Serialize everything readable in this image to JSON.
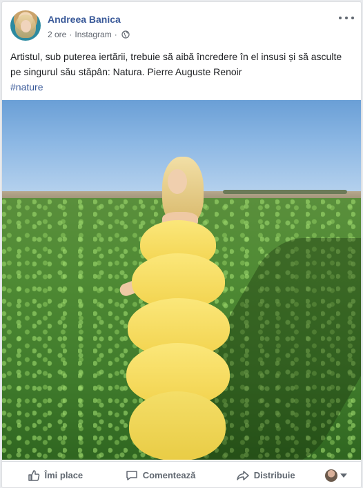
{
  "post": {
    "author": "Andreea Banica",
    "time": "2 ore",
    "separator": "·",
    "source": "Instagram",
    "text": "Artistul, sub puterea iertării, trebuie să aibă încredere în el insusi și să asculte pe singurul său stăpân: Natura. Pierre Auguste Renoir",
    "hashtag": "#nature",
    "privacy_icon": "globe-icon",
    "menu_icon": "more-icon"
  },
  "actions": {
    "like": {
      "label": "Îmi place",
      "icon": "like-icon"
    },
    "comment": {
      "label": "Comentează",
      "icon": "comment-icon"
    },
    "share": {
      "label": "Distribuie",
      "icon": "share-icon"
    },
    "audience_icon": "chevron-down-icon"
  },
  "colors": {
    "link": "#385898",
    "text": "#1c1e21",
    "secondary": "#616770",
    "background": "#e9ebee"
  }
}
